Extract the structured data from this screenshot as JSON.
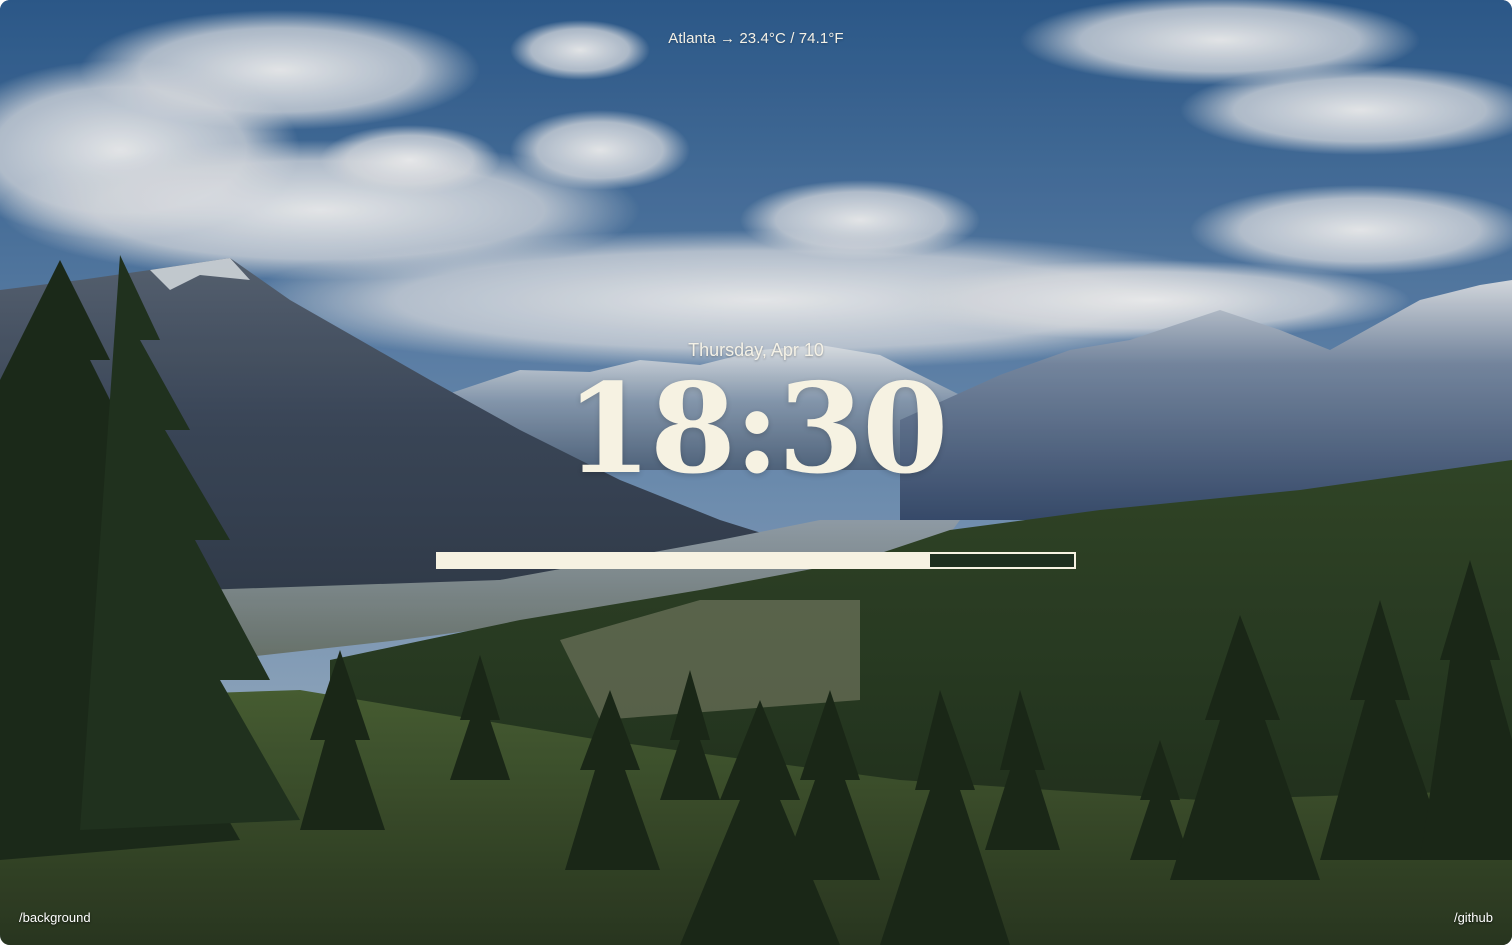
{
  "weather": {
    "text": "Atlanta → 23.4°C / 74.1°F"
  },
  "clock": {
    "date": "Thursday, Apr 10",
    "time": "18:30"
  },
  "progress": {
    "fraction": 0.773
  },
  "footer": {
    "background_link": "/background",
    "github_link": "/github"
  },
  "colors": {
    "text": "#f6f2e2",
    "sky": "#3f6c9e",
    "forest": "#2e3f26"
  }
}
